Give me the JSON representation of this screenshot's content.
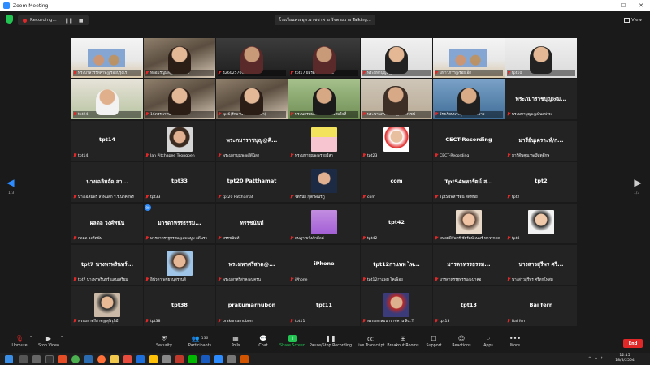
{
  "window": {
    "title": "Zoom Meeting",
    "min": "—",
    "max": "☐",
    "close": "✕"
  },
  "topbar": {
    "recording": "Recording...",
    "pause": "❚❚",
    "stop": "■",
    "speaker": "โรงเรียนพระยุหวราชชาพาย รัชดาถวาย Talking...",
    "view": "View"
  },
  "pages": {
    "left": "1/3",
    "right": "1/3"
  },
  "tiles": [
    {
      "name": "พระบาลวรรีทศาท์@ร้อยปุรุงไร",
      "center": "",
      "kind": "video",
      "bg": "bg-slide"
    },
    {
      "name": "ท่ออมีรัญมล@ฯพึ่งง...ส่ง",
      "center": "",
      "kind": "video",
      "bg": "bg-room"
    },
    {
      "name": "4260257002",
      "center": "",
      "kind": "video",
      "bg": "bg-dark"
    },
    {
      "name": "tpt17 ยลรด เทนครวิทย์",
      "center": "",
      "kind": "video",
      "bg": "bg-dark"
    },
    {
      "name": "พระมหาบุญพ@ลักวม",
      "center": "",
      "kind": "video",
      "bg": "bg-white"
    },
    {
      "name": "มหาวิภาฯ@ร้อยเอ็ด",
      "center": "",
      "kind": "video",
      "bg": "bg-slide"
    },
    {
      "name": "tpt10",
      "center": "",
      "kind": "video",
      "bg": "bg-white"
    },
    {
      "name": "tpt24",
      "center": "",
      "kind": "video",
      "bg": "bg-window"
    },
    {
      "name": "16ครรพาทบรจตาพาน",
      "center": "",
      "kind": "video",
      "bg": "bg-room"
    },
    {
      "name": "tpt6(รักษาพรม ชยะศึกษา)",
      "center": "",
      "kind": "video",
      "bg": "bg-room"
    },
    {
      "name": "พระนครพนสงศาลตำรวจสมใจที่",
      "center": "",
      "kind": "video",
      "bg": "bg-green"
    },
    {
      "name": "พระนานคราชคุณ@วารราชน์",
      "center": "",
      "kind": "video",
      "bg": "bg-office"
    },
    {
      "name": "โรงเรียนพระยุหวราชชาพาย",
      "center": "",
      "kind": "video",
      "bg": "bg-blue"
    },
    {
      "name": "พระมหาบุญพ@มีนอฟรพ",
      "center": "พระภมาราชบุญ@ม...",
      "kind": "name"
    },
    {
      "name": "tpt14",
      "center": "tpt14",
      "kind": "name"
    },
    {
      "name": "Jan Pitchapee Teongpen",
      "center": "",
      "kind": "avatar",
      "av": "av1"
    },
    {
      "name": "พระมหาบุญพ@สีดีนิลา",
      "center": "พระภมาราชบุญ@ศึ...",
      "kind": "name"
    },
    {
      "name": "พระมหาบุญพ@รายจีสา",
      "center": "",
      "kind": "avatar",
      "av": "av2"
    },
    {
      "name": "tpt23",
      "center": "",
      "kind": "avatar",
      "av": "av4"
    },
    {
      "name": "CECT-Recording",
      "center": "CECT-Recording",
      "kind": "name"
    },
    {
      "name": "มารีดีนคุณาพ@ัสดุศึกษ",
      "center": "มารีย์นุเคราะห์/ก...",
      "kind": "name"
    },
    {
      "name": "นางเฉลิมพร ลาพนสก ร.ร.นาคาพร",
      "center": "นางเฉลิมจัด  ลา...",
      "kind": "name"
    },
    {
      "name": "tpt33",
      "center": "tpt33",
      "kind": "name"
    },
    {
      "name": "tpt20 Patthamat",
      "center": "tpt20 Patthamat",
      "kind": "name"
    },
    {
      "name": "จิตรนัย กุลักษณ์ร์ภู",
      "center": "",
      "kind": "avatar",
      "av": "av3"
    },
    {
      "name": "com",
      "center": "com",
      "kind": "name"
    },
    {
      "name": "Tpt54พหารัตน์ สดทันย์",
      "center": "Tpt54พหารัตน์ ส...",
      "kind": "name"
    },
    {
      "name": "tpt2",
      "center": "tpt2",
      "kind": "name"
    },
    {
      "name": "กลดล วงศ์ตนัน",
      "center": "ผลดล วงศ์ทนัน",
      "kind": "name"
    },
    {
      "name": "มารดาหรรฐทรรม@ลพนบูบ อดีนรา",
      "center": "มารดาหรรธรรม...",
      "kind": "name",
      "badge": "90"
    },
    {
      "name": "ทรรชนันท์",
      "center": "ทรรชนันท์",
      "kind": "name"
    },
    {
      "name": "ดุษฎา ขวังภักดีลต์",
      "center": "",
      "kind": "avatar",
      "av": "av5"
    },
    {
      "name": "tpt42",
      "center": "tpt42",
      "kind": "name"
    },
    {
      "name": "หน่อมฝีจันทร์ ชัยรัตน์พนมร์ ทาวรกลด",
      "center": "",
      "kind": "avatar",
      "av": "av6"
    },
    {
      "name": "tpt8",
      "center": "",
      "kind": "avatar",
      "av": "av7"
    },
    {
      "name": "tpt7 นางพรพรินทร์ แสนเสริยม",
      "center": "tpt7 นางพรพรินทร์...",
      "kind": "name"
    },
    {
      "name": "อินัวดา พชยานุสรรนส์",
      "center": "",
      "kind": "avatar",
      "av": "av8"
    },
    {
      "name": "พระมหาศรีสาค@นครน",
      "center": "พระมหาศรีสาค@...",
      "kind": "name"
    },
    {
      "name": "iPhone",
      "center": "iPhone",
      "kind": "name"
    },
    {
      "name": "tpt12กาแพท โคเพ็อย",
      "center": "tpt12กาแพท ไพ...",
      "kind": "name"
    },
    {
      "name": "มารดาหรรฐทรรม@นาคอ",
      "center": "มารดาหรรธรรม...",
      "kind": "name"
    },
    {
      "name": "นางสาวสุรีพร ศรีทกโพสท",
      "center": "นางสาวสุรีพร ศรี...",
      "kind": "name"
    },
    {
      "name": "พระมหาศรีสาค@สุนิรุภิมี",
      "center": "",
      "kind": "avatar",
      "av": "av9"
    },
    {
      "name": "tpt38",
      "center": "tpt38",
      "kind": "name"
    },
    {
      "name": "prakumarnubon",
      "center": "prakumarnubon",
      "kind": "name"
    },
    {
      "name": "tpt11",
      "center": "tpt11",
      "kind": "name"
    },
    {
      "name": "พระมหาสมนาราชคาน ลิง..T",
      "center": "",
      "kind": "avatar",
      "av": "av10"
    },
    {
      "name": "tpt13",
      "center": "tpt13",
      "kind": "name"
    },
    {
      "name": "Bai fern",
      "center": "Bai fern",
      "kind": "name"
    }
  ],
  "toolbar": {
    "unmute": "Unmute",
    "stop_video": "Stop Video",
    "security": "Security",
    "participants": "Participants",
    "participants_count": "136",
    "polls": "Polls",
    "chat": "Chat",
    "share_screen": "Share Screen",
    "pause_recording": "Pause/Stop Recording",
    "live_transcript": "Live Transcript",
    "breakout_rooms": "Breakout Rooms",
    "support": "Support",
    "reactions": "Reactions",
    "apps": "Apps",
    "more": "More",
    "end": "End"
  },
  "taskbar": {
    "time": "12:15",
    "date": "18/8/2564"
  },
  "colors": {
    "accent": "#2d8cff",
    "share_green": "#23c552",
    "end_red": "#e02828",
    "tile_bg": "#232323"
  }
}
